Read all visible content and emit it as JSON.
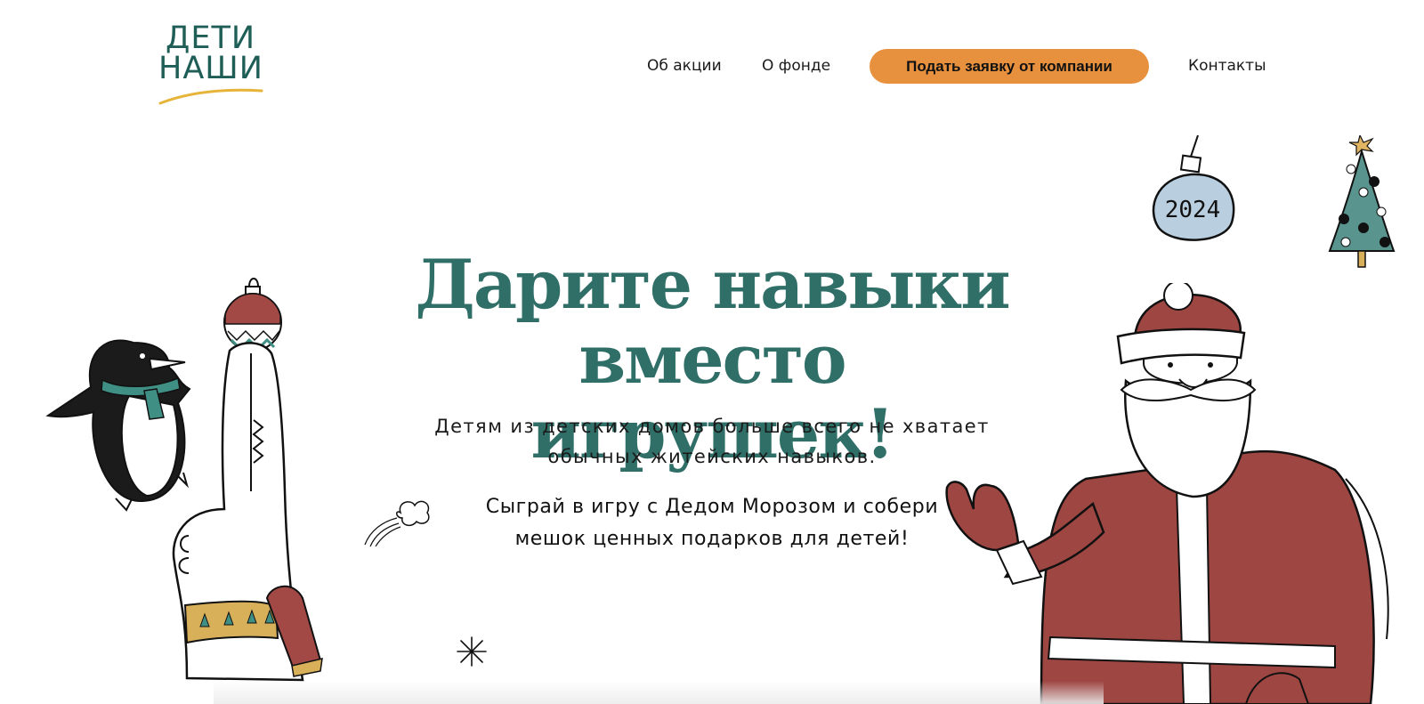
{
  "logo": {
    "line1": "ДЕТИ",
    "line2": "НАШИ"
  },
  "nav": {
    "about": "Об акции",
    "fund": "О фонде",
    "cta": "Подать заявку от компании",
    "contacts": "Контакты"
  },
  "hero": {
    "title_line1": "Дарите навыки",
    "title_line2": "вместо игрушек!",
    "subtitle_line1": "Детям из детских домов больше всего не хватает",
    "subtitle_line2": "обычных житейских навыков.",
    "call_line1": "Сыграй в игру с Дедом Морозом и собери",
    "call_line2": "мешок ценных подарков для детей!"
  },
  "ornament": {
    "year": "2024"
  },
  "colors": {
    "brand_green": "#2f6f68",
    "logo_green": "#1f5d57",
    "accent_orange": "#e7913f",
    "santa_red": "#9e4642",
    "tree_green": "#5a948e",
    "ornament_blue": "#b9cfe0"
  },
  "icons": [
    "penguin-illustration",
    "hand-with-ornament-illustration",
    "santa-claus-illustration",
    "ornament-2024-icon",
    "christmas-tree-icon",
    "snowball-icon",
    "snowflake-icon"
  ]
}
